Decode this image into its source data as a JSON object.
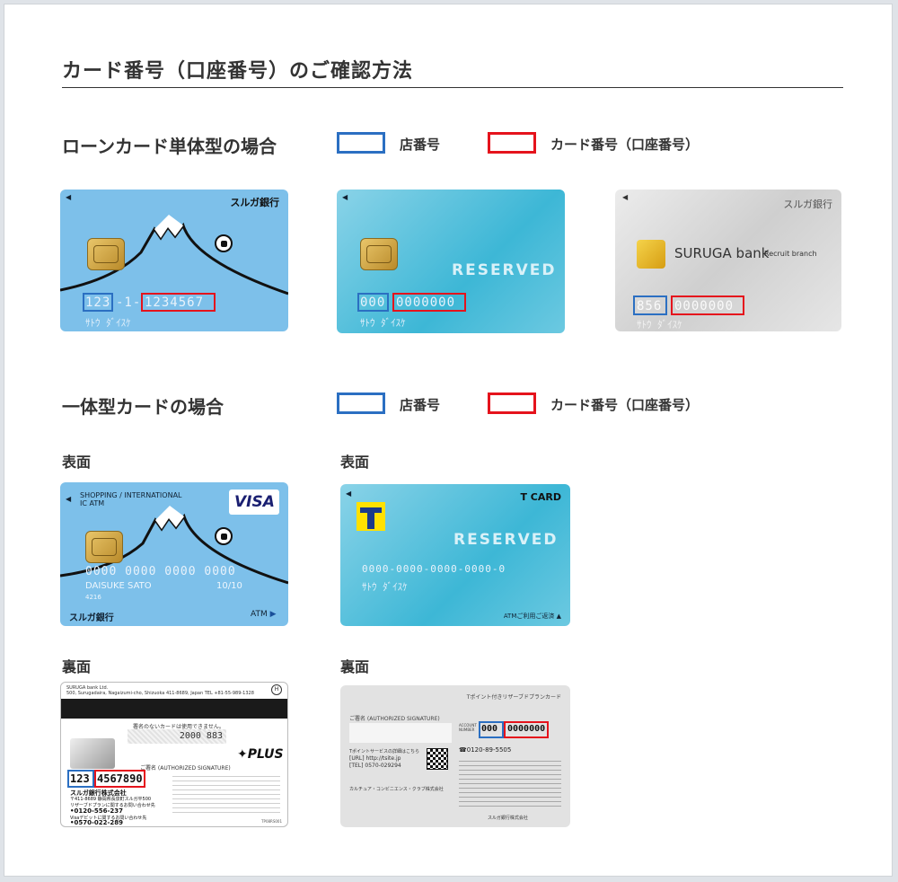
{
  "page": {
    "title": "カード番号（口座番号）のご確認方法"
  },
  "section1": {
    "heading": "ローンカード単体型の場合",
    "legend_branch": "店番号",
    "legend_account": "カード番号（口座番号）"
  },
  "section2": {
    "heading": "一体型カードの場合",
    "legend_branch": "店番号",
    "legend_account": "カード番号（口座番号）"
  },
  "labels": {
    "front_1": "表面",
    "front_2": "表面",
    "back_1": "裏面",
    "back_2": "裏面"
  },
  "card1": {
    "bank": "スルガ銀行",
    "branch": "123",
    "sep": "-1-",
    "account": "1234567",
    "name": "ｻﾄｳ ﾀﾞｲｽｹ"
  },
  "card2": {
    "logo": "RESERVED",
    "branch": "000",
    "account": "0000000",
    "name": "ｻﾄｳ ﾀﾞｲｽｹ"
  },
  "card3": {
    "bank": "スルガ銀行",
    "brand": "SURUGA bank",
    "sub": "Recruit branch",
    "branch": "856",
    "account": "0000000",
    "name": "ｻﾄｳ ﾀﾞｲｽｹ"
  },
  "card4": {
    "tag1": "SHOPPING / INTERNATIONAL",
    "tag2": "IC ATM",
    "brand": "VISA",
    "number": "0000 0000 0000 0000",
    "holder": "DAISUKE SATO",
    "expiry": "10/10",
    "small": "4216",
    "bank": "スルガ銀行",
    "atm": "ATM"
  },
  "card5": {
    "header": "T CARD",
    "logo": "RESERVED",
    "number": "0000-0000-0000-0000-0",
    "name": "ｻﾄｳ ﾀﾞｲｽｹ",
    "footer": "ATMご利用ご返済"
  },
  "card6": {
    "addr1": "SURUGA bank Ltd.",
    "addr2": "500, Surugadaira, Nagaizumi-cho, Shizuoka 411-8689, Japan   TEL +81-55-989-1328",
    "sign_notice": "署名のないカードは使用できません。",
    "number_mark": "2000 883",
    "plus": "PLUS",
    "signature": "ご署名 (AUTHORIZED SIGNATURE)",
    "branch": "123",
    "account": "4567890",
    "company": "スルガ銀行株式会社",
    "address": "〒411-8689 静岡県長泉町スルガ平500",
    "inquiry1": "リザーブドプランに関するお問い合わせ先",
    "tel1": "0120-556-237",
    "inquiry2": "Visaデビットに関するお問い合わせ先",
    "tel2": "0570-022-289",
    "footer": "TP08RS001"
  },
  "card7": {
    "header": "Tポイント付きリザーブドプランカード",
    "signature": "ご署名 (AUTHORIZED SIGNATURE)",
    "account_label": "ACCOUNT NUMBER",
    "branch": "000",
    "account": "0000000",
    "loan_tel": "0120-89-5505",
    "tpoint": "Tポイントサービスの詳細はこちら",
    "url": "[URL] http://tsite.jp",
    "tel": "[TEL] 0570-029294",
    "company1": "カルチュア・コンビニエンス・クラブ株式会社",
    "company2": "スルガ銀行株式会社"
  },
  "colors": {
    "blue": "#2b6fc2",
    "red": "#e5131c",
    "card_blue": "#7dc0ea"
  }
}
